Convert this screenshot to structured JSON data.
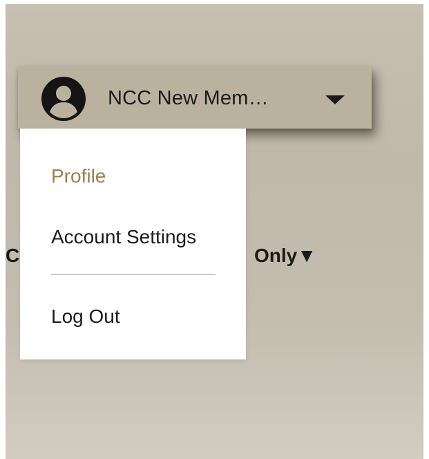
{
  "account": {
    "name": "NCC New Mem…",
    "avatar_icon": "user-circle-icon",
    "caret_icon": "caret-down-icon"
  },
  "background": {
    "filter_left_fragment": "C",
    "filter_label": "Only▼"
  },
  "menu": {
    "items": [
      {
        "label": "Profile",
        "active": true
      },
      {
        "label": "Account Settings",
        "active": false
      },
      {
        "label": "Log Out",
        "active": false
      }
    ]
  },
  "colors": {
    "account_bar": "#bab29f",
    "active_item": "#a07d52",
    "text": "#1b1b1b",
    "divider": "#c9c9c9"
  }
}
